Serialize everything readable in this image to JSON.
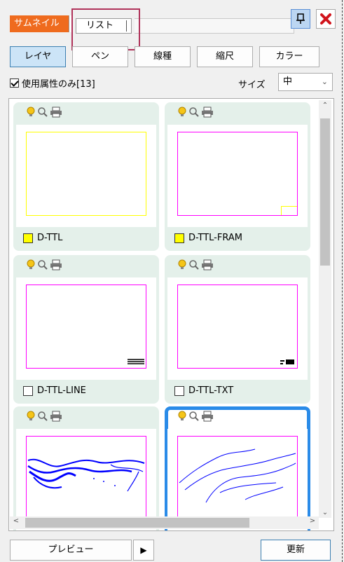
{
  "tabs": {
    "thumbnail_label": "サムネイル",
    "list_label": "リスト"
  },
  "toolbar": {
    "pin_label": "ロ",
    "close_label": "×"
  },
  "filters": [
    "レイヤ",
    "ペン",
    "線種",
    "縮尺",
    "カラー"
  ],
  "options": {
    "checkbox_label": "使用属性のみ[13]",
    "checkbox_checked": true,
    "size_label": "サイズ",
    "size_value": "中"
  },
  "layers": [
    {
      "name": "D-TTL",
      "color": "#ffff00",
      "frame_color": "#ffff00"
    },
    {
      "name": "D-TTL-FRAM",
      "color": "#ffff00",
      "frame_color": "#ff00ff"
    },
    {
      "name": "D-TTL-LINE",
      "color": "#ffffff",
      "frame_color": "#ff00ff"
    },
    {
      "name": "D-TTL-TXT",
      "color": "#ffffff",
      "frame_color": "#ff00ff"
    },
    {
      "name": "",
      "color": "",
      "frame_color": "#ff00ff"
    },
    {
      "name": "",
      "color": "",
      "frame_color": "#ff00ff",
      "selected": true
    }
  ],
  "bottom": {
    "preview_label": "プレビュー",
    "play_label": "▶",
    "refresh_label": "更新"
  },
  "colors": {
    "accent_tab": "#ef6b1e",
    "selection": "#2a8be8",
    "card_bg": "#e4f0ea",
    "highlight": "#b0335a"
  }
}
